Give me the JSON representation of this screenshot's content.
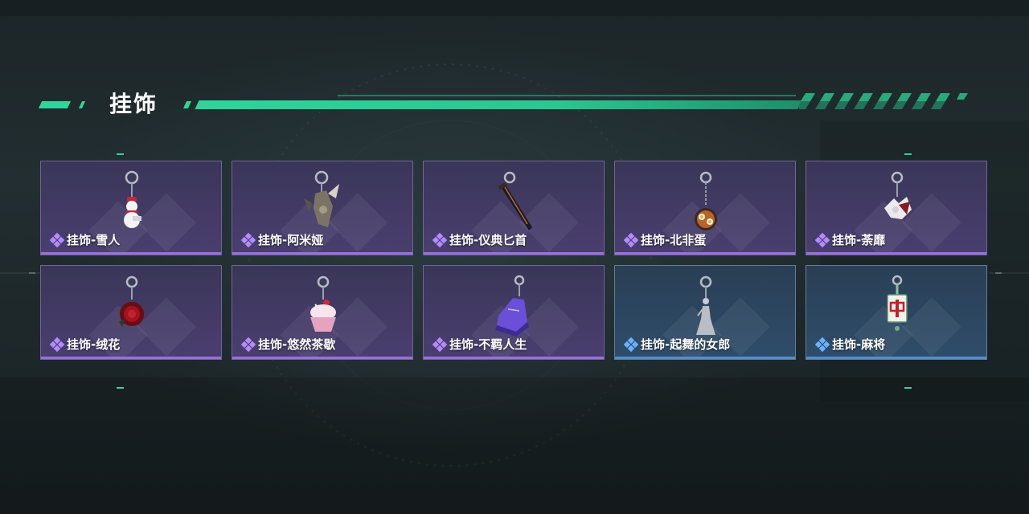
{
  "page": {
    "title": "挂饰"
  },
  "colors": {
    "accent": "#2fd59a",
    "rarity_purple": "#9a6fe0",
    "rarity_blue": "#4f8fd0"
  },
  "items": [
    {
      "name": "挂饰-雪人",
      "rarity": "purple",
      "icon": "snowman-charm-icon"
    },
    {
      "name": "挂饰-阿米娅",
      "rarity": "purple",
      "icon": "rabbit-charm-icon"
    },
    {
      "name": "挂饰-仪典匕首",
      "rarity": "purple",
      "icon": "dagger-charm-icon"
    },
    {
      "name": "挂饰-北非蛋",
      "rarity": "purple",
      "icon": "shakshuka-charm-icon"
    },
    {
      "name": "挂饰-荼靡",
      "rarity": "purple",
      "icon": "flower-charm-icon"
    },
    {
      "name": "挂饰-绒花",
      "rarity": "purple",
      "icon": "rose-charm-icon"
    },
    {
      "name": "挂饰-悠然茶歇",
      "rarity": "purple",
      "icon": "cupcake-charm-icon"
    },
    {
      "name": "挂饰-不羁人生",
      "rarity": "purple",
      "icon": "sneaker-charm-icon"
    },
    {
      "name": "挂饰-起舞的女郎",
      "rarity": "blue",
      "icon": "dancer-charm-icon"
    },
    {
      "name": "挂饰-麻将",
      "rarity": "blue",
      "icon": "mahjong-charm-icon"
    }
  ]
}
